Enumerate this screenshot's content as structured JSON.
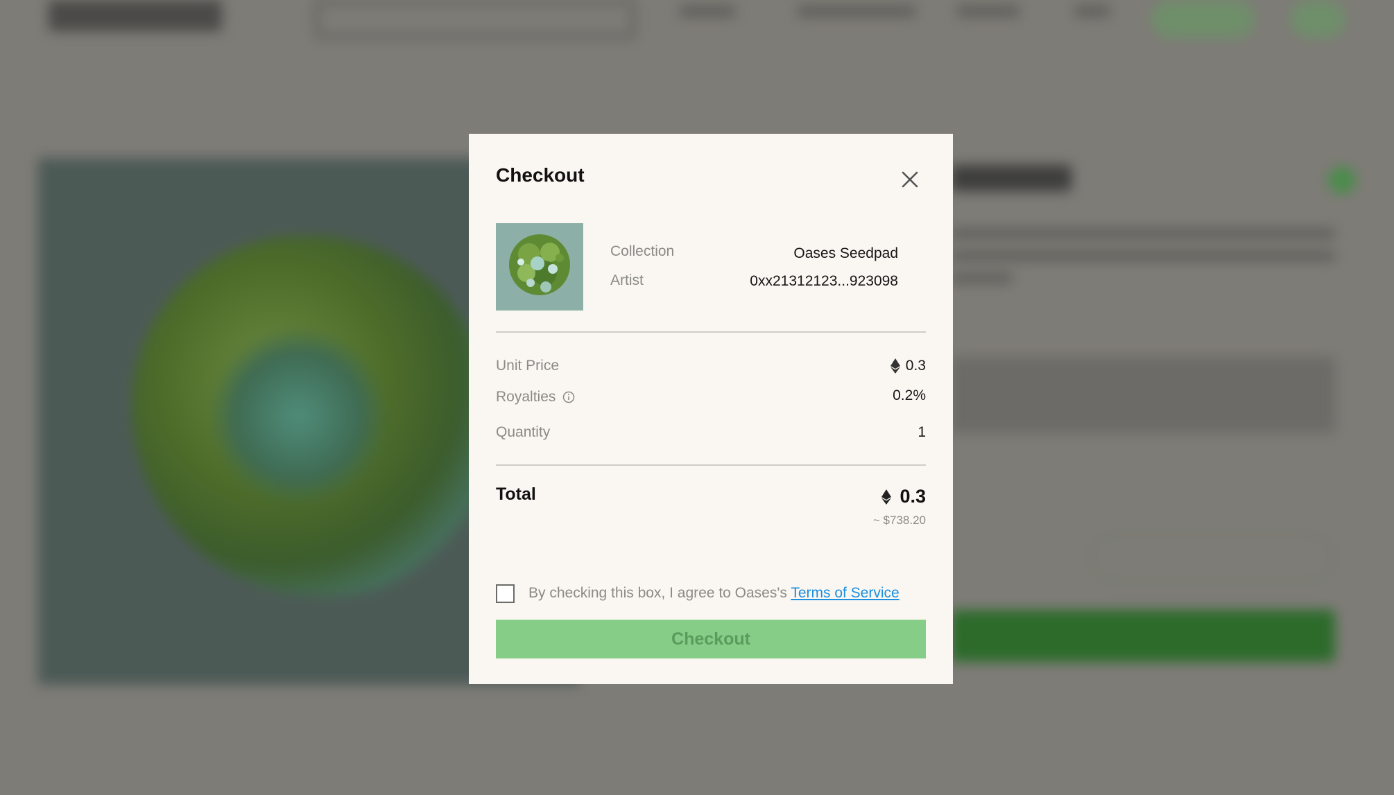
{
  "modal": {
    "title": "Checkout",
    "close_icon": "close-icon",
    "artwork_icon": "artwork-thumbnail",
    "collection_label": "Collection",
    "collection_value": "Oases Seedpad",
    "artist_label": "Artist",
    "artist_value": "0xx21312123...923098",
    "unit_price_label": "Unit Price",
    "unit_price_value": "0.3",
    "royalties_label": "Royalties",
    "royalties_value": "0.2%",
    "quantity_label": "Quantity",
    "quantity_value": "1",
    "total_label": "Total",
    "total_value": "0.3",
    "total_usd": "~ $738.20",
    "agree_text": "By checking this box, I agree to Oases's ",
    "tos_link": "Terms of Service",
    "checkbox_checked": false,
    "checkout_button": "Checkout"
  },
  "colors": {
    "overlay": "#7e7c77",
    "modal_bg": "#faf7f2",
    "button_bg": "#86ce88",
    "button_text": "#5a9c5c",
    "link": "#1b8fe0"
  }
}
